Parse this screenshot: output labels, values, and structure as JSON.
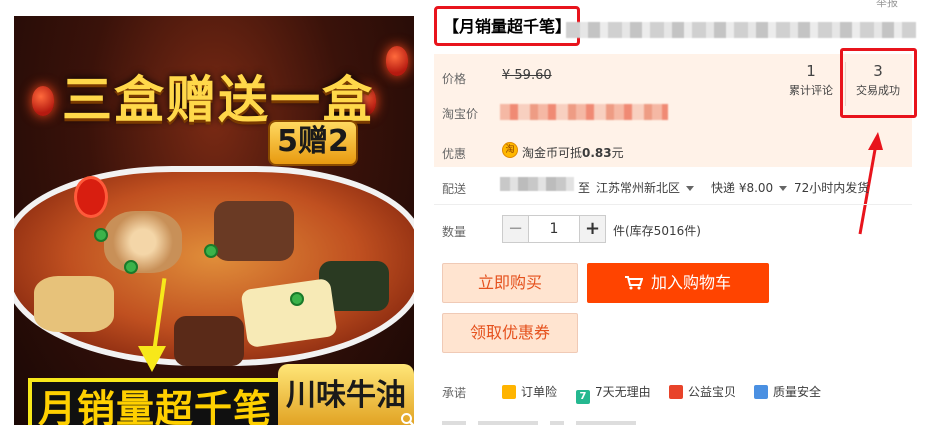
{
  "product_image": {
    "headline": "三盒赠送一盒",
    "badge": "5赠2",
    "caption": "月销量超千笔",
    "tag": "川味牛油",
    "zoom_icon": "magnifier-icon"
  },
  "header": {
    "title_highlight": "【月销量超千笔】",
    "top_right": "举报"
  },
  "price": {
    "label": "价格",
    "original": "¥ 59.60",
    "taobao_label": "淘宝价"
  },
  "stats": {
    "reviews_count": "1",
    "reviews_label": "累计评论",
    "sales_count": "3",
    "sales_label": "交易成功"
  },
  "promo": {
    "label": "优惠",
    "icon_char": "淘",
    "text_prefix": "淘金币可抵",
    "amount": "0.83",
    "text_suffix": "元"
  },
  "shipping": {
    "label": "配送",
    "to": "至",
    "destination": "江苏常州新北区",
    "method": "快递 ¥8.00",
    "eta": "72小时内发货"
  },
  "quantity": {
    "label": "数量",
    "minus": "−",
    "plus": "+",
    "value": "1",
    "stock": "件(库存5016件)"
  },
  "buttons": {
    "buy_now": "立即购买",
    "add_to_cart": "加入购物车",
    "get_coupon": "领取优惠券"
  },
  "promises": {
    "label": "承诺",
    "items": [
      {
        "label": "订单险",
        "color": "#ffb400",
        "icon": "shield-icon"
      },
      {
        "label": "7天无理由",
        "color": "#25b890",
        "icon": "seven-day-icon",
        "glyph": "7"
      },
      {
        "label": "公益宝贝",
        "color": "#e8432a",
        "icon": "heart-icon"
      },
      {
        "label": "质量安全",
        "color": "#4a90e2",
        "icon": "quality-icon"
      }
    ]
  },
  "colors": {
    "accent": "#ff4400",
    "highlight_border": "#e8141c",
    "price_panel_bg": "#fff2e8"
  }
}
